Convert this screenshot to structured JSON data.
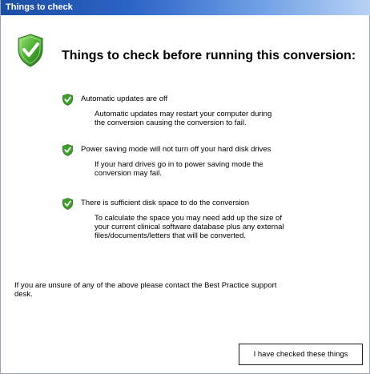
{
  "window": {
    "title": "Things to check"
  },
  "header": {
    "icon": "shield-check-icon",
    "title": "Things to check before running this conversion:"
  },
  "checks": [
    {
      "icon": "shield-check-icon",
      "title": "Automatic updates are off",
      "desc_lines": [
        "Automatic updates may restart your computer during",
        "the conversion causing the conversion to fail."
      ]
    },
    {
      "icon": "shield-check-icon",
      "title": "Power saving mode will not turn off your hard disk drives",
      "desc_lines": [
        "If your hard drives go in to power saving mode the",
        "conversion may fail."
      ]
    },
    {
      "icon": "shield-check-icon",
      "title": "There is sufficient disk space to do the conversion",
      "desc_lines": [
        "To calculate the space you may need add up the size of",
        "your current clinical software database plus any external",
        "files/documents/letters that will be converted."
      ]
    }
  ],
  "footer": {
    "note_lines": [
      "If you are unsure of any of the above please contact the Best Practice support",
      "desk."
    ]
  },
  "actions": {
    "confirm_label": "I have checked these things"
  },
  "colors": {
    "title_bar_start": "#1c4ea3",
    "title_bar_end": "#b9d2f3",
    "shield_green": "#3f9f2e",
    "background": "#ffffff"
  }
}
